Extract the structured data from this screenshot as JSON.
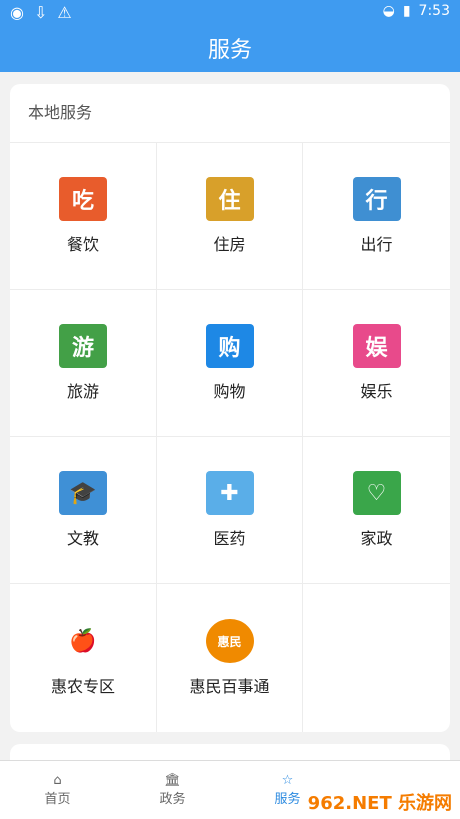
{
  "status": {
    "time": "7:53"
  },
  "header": {
    "title": "服务"
  },
  "section": {
    "title": "本地服务"
  },
  "services": [
    {
      "label": "餐饮",
      "icon_text": "吃",
      "bg": "#e85c2c"
    },
    {
      "label": "住房",
      "icon_text": "住",
      "bg": "#d8a02a"
    },
    {
      "label": "出行",
      "icon_text": "行",
      "bg": "#3f8fd2"
    },
    {
      "label": "旅游",
      "icon_text": "游",
      "bg": "#43a047"
    },
    {
      "label": "购物",
      "icon_text": "购",
      "bg": "#1e88e5"
    },
    {
      "label": "娱乐",
      "icon_text": "娱",
      "bg": "#e84a8b"
    },
    {
      "label": "文教",
      "icon_text": "🎓",
      "bg": "#3f90d6"
    },
    {
      "label": "医药",
      "icon_text": "✚",
      "bg": "#5aaee8"
    },
    {
      "label": "家政",
      "icon_text": "♡",
      "bg": "#3aa64a"
    },
    {
      "label": "惠农专区",
      "icon_text": "🍎",
      "bg": "#ffffff"
    },
    {
      "label": "惠民百事通",
      "icon_text": "惠民",
      "bg": "#f08a00"
    }
  ],
  "tabs": [
    {
      "label": "首页",
      "icon": "home-icon"
    },
    {
      "label": "政务",
      "icon": "government-icon"
    },
    {
      "label": "服务",
      "icon": "service-star-icon"
    },
    {
      "label": "",
      "icon": ""
    }
  ],
  "watermark": "962.NET 乐游网"
}
